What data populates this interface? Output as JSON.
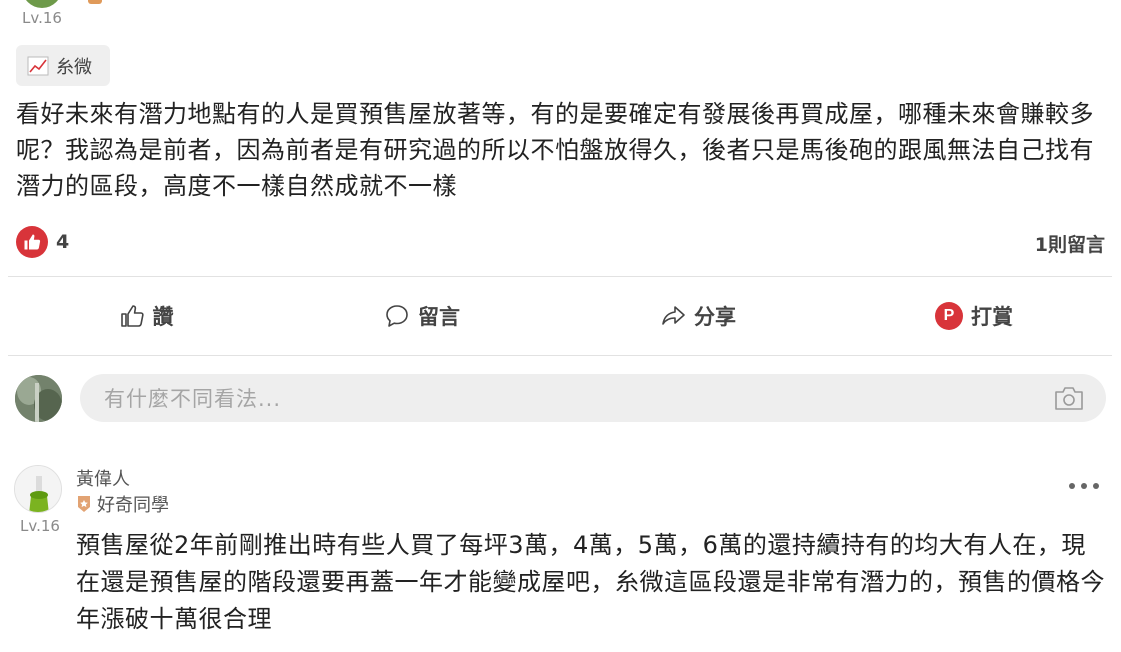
{
  "post": {
    "author_level": "Lv.16",
    "tag": "糸微",
    "body": "看好未來有潛力地點有的人是買預售屋放著等，有的是要確定有發展後再買成屋，哪種未來會賺較多呢？我認為是前者，因為前者是有研究過的所以不怕盤放得久，後者只是馬後砲的跟風無法自己找有潛力的區段，高度不一樣自然成就不一樣",
    "like_count": "4",
    "comment_count": "1則留言"
  },
  "actions": {
    "like": "讚",
    "comment": "留言",
    "share": "分享",
    "tip": "打賞",
    "tip_badge": "P"
  },
  "composer": {
    "placeholder": "有什麼不同看法..."
  },
  "comment": {
    "author": "黃偉人",
    "title": "好奇同學",
    "level": "Lv.16",
    "body": "預售屋從2年前剛推出時有些人買了每坪3萬，4萬，5萬，6萬的還持續持有的均大有人在，現在還是預售屋的階段還要再蓋一年才能變成屋吧，糸微這區段還是非常有潛力的，預售的價格今年漲破十萬很合理"
  },
  "colors": {
    "accent_red": "#d8343a",
    "text": "#222222",
    "muted": "#8a8a8a"
  }
}
